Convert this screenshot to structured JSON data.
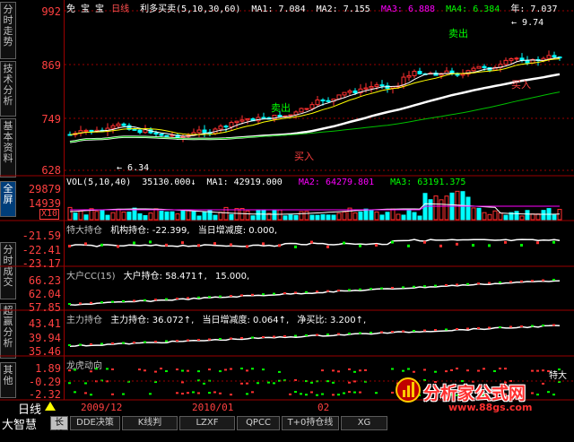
{
  "sidebar": {
    "tabs": [
      {
        "label": "分时走势",
        "active": false
      },
      {
        "label": "技术分析",
        "active": false
      },
      {
        "label": "基本资料",
        "active": false
      },
      {
        "label": "全屏",
        "active": true
      },
      {
        "label": "分时成交",
        "active": false
      },
      {
        "label": "超赢分析",
        "active": false
      },
      {
        "label": "其他",
        "active": false
      }
    ]
  },
  "main": {
    "stock_name": "免 宝 宝",
    "period": "日线",
    "indicator_name": "利多买卖(5,10,30,60)",
    "ma": [
      {
        "label": "MA1:",
        "value": "7.084",
        "color": "#ffffff"
      },
      {
        "label": "MA2:",
        "value": "7.155",
        "color": "#ffff00"
      },
      {
        "label": "MA3:",
        "value": "6.888",
        "color": "#ff00ff"
      },
      {
        "label": "MA4:",
        "value": "6.384",
        "color": "#00ff00"
      },
      {
        "label": "年:",
        "value": "7.037",
        "color": "#ffffff"
      }
    ],
    "y_labels": [
      "992",
      "869",
      "749",
      "628"
    ],
    "annotations": {
      "high": "9.74",
      "low": "6.34",
      "sell1": "卖出",
      "sell2": "卖出",
      "buy1": "买入",
      "buy2": "买入"
    }
  },
  "volume": {
    "title": "VOL(5,10,40)",
    "value": "35130.000↓",
    "ma": [
      {
        "label": "MA1:",
        "value": "42919.000",
        "color": "#ffffff"
      },
      {
        "label": "MA2:",
        "value": "64279.801",
        "color": "#ff00ff"
      },
      {
        "label": "MA3:",
        "value": "63191.375",
        "color": "#00ff00"
      }
    ],
    "y_labels": [
      "29879",
      "14939"
    ],
    "unit": "X10"
  },
  "panel1": {
    "title": "特大持仓",
    "text1": "机构持仓: -22.399,",
    "text2": "当日增减度: 0.000,",
    "y_labels": [
      "-21.59",
      "-22.41",
      "-23.17"
    ]
  },
  "panel2": {
    "title": "大户CC(15)",
    "text1": "大户持仓: 58.471↑,",
    "text2": "15.000,",
    "y_labels": [
      "66.23",
      "62.04",
      "57.85"
    ]
  },
  "panel3": {
    "title": "主力持仓",
    "text1": "主力持仓: 36.072↑,",
    "text2": "当日增减度: 0.064↑,",
    "text3": "净买比: 3.200↑,",
    "y_labels": [
      "43.41",
      "39.94",
      "35.46"
    ]
  },
  "panel4": {
    "title": "龙虎动向",
    "y_labels": [
      "1.89",
      "-0.29",
      "-2.32"
    ],
    "right_label": "特大"
  },
  "bottom": {
    "period_label": "日线",
    "dates": [
      "2009/12",
      "2010/01",
      "02"
    ],
    "brand": "大智慧",
    "tabs": [
      "长线",
      "DDE决策",
      "K线判",
      "LZXF",
      "QPCC",
      "T+0持仓线",
      "XG"
    ]
  },
  "watermark": {
    "line1": "分析家公式网",
    "line2": "www.88gs.com"
  },
  "colors": {
    "up": "#ff3030",
    "down": "#00ffff",
    "grid": "#9a0000",
    "white": "#ffffff"
  }
}
